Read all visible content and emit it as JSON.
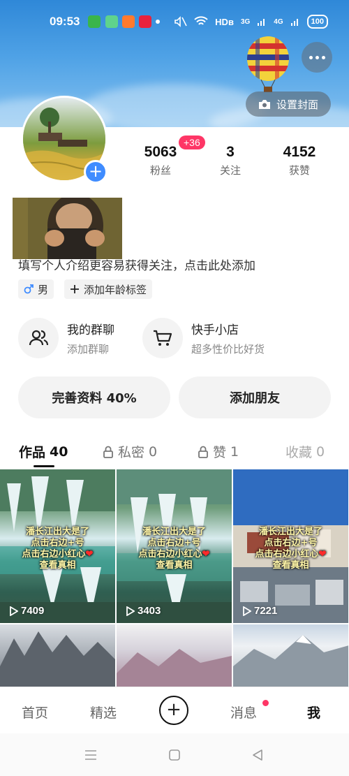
{
  "status_bar": {
    "time": "09:53",
    "network": "HDв",
    "signal_1": "3G",
    "signal_2": "4G",
    "battery": "100"
  },
  "header": {
    "set_cover_label": "设置封面",
    "more_icon": "more-horizontal-icon"
  },
  "profile": {
    "stats": [
      {
        "value": "5063",
        "label": "粉丝"
      },
      {
        "value": "3",
        "label": "关注"
      },
      {
        "value": "4152",
        "label": "获赞"
      }
    ],
    "fans_badge": "+36",
    "intro_placeholder": "填写个人介绍更容易获得关注，点击此处添加",
    "tags": [
      {
        "icon": "male-icon",
        "label": "男"
      },
      {
        "icon": "plus-icon",
        "label": "添加年龄标签"
      }
    ]
  },
  "shortcuts": [
    {
      "title": "我的群聊",
      "subtitle": "添加群聊",
      "icon": "group-chat-icon"
    },
    {
      "title": "快手小店",
      "subtitle": "超多性价比好货",
      "icon": "shopping-cart-icon"
    }
  ],
  "actions": {
    "complete_profile": "完善资料 40%",
    "add_friend": "添加朋友"
  },
  "tabs": [
    {
      "label": "作品",
      "count": "40",
      "locked": false,
      "active": true
    },
    {
      "label": "私密",
      "count": "0",
      "locked": true,
      "active": false
    },
    {
      "label": "赞",
      "count": "1",
      "locked": true,
      "active": false
    },
    {
      "label": "收藏",
      "count": "0",
      "locked": false,
      "active": false
    }
  ],
  "grid": {
    "caption_line1": "潘长江出大是了",
    "caption_line2": "点击右边+号",
    "caption_line3": "点击右边小红心",
    "caption_line4": "查看真相",
    "items": [
      {
        "play_count": "7409"
      },
      {
        "play_count": "3403"
      },
      {
        "play_count": "7221"
      }
    ]
  },
  "bottom_nav": {
    "home": "首页",
    "featured": "精选",
    "messages": "消息",
    "me": "我"
  },
  "colors": {
    "accent_red": "#fe3666",
    "accent_blue": "#3f8cff",
    "banner_blue": "#2f88d8"
  }
}
